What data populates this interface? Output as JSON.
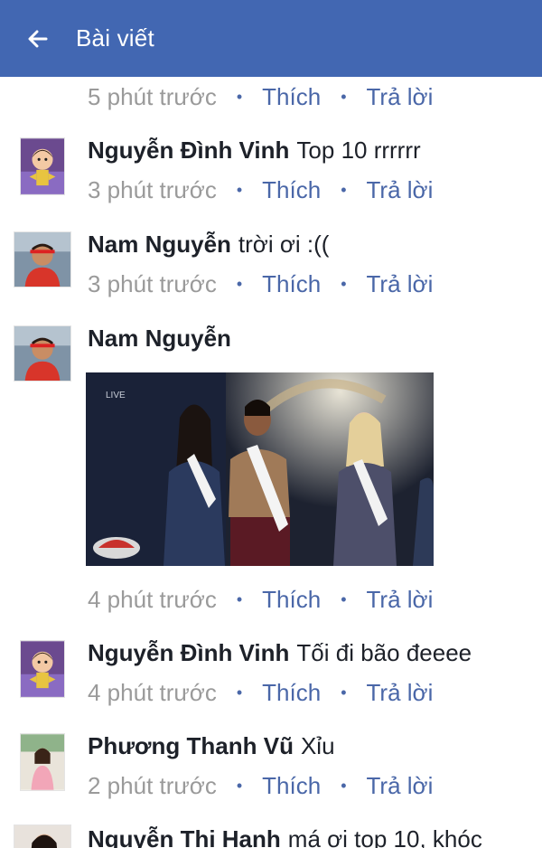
{
  "header": {
    "back_icon": "back-arrow-icon",
    "title": "Bài viết"
  },
  "actions": {
    "like": "Thích",
    "reply": "Trả lời",
    "separator": "•"
  },
  "top_meta": {
    "time": "5 phút trước"
  },
  "comments": [
    {
      "name": "Nguyễn Đình Vinh",
      "text": "Top 10 rrrrrr",
      "time": "3 phút trước"
    },
    {
      "name": "Nam Nguyễn",
      "text": "trời ơi :((",
      "time": "3 phút trước"
    },
    {
      "name": "Nam Nguyễn",
      "text": "",
      "time": "4 phút trước",
      "photo_label": "LIVE"
    },
    {
      "name": "Nguyễn Đình Vinh",
      "text": "Tối đi bão đeeee",
      "time": "4 phút trước"
    },
    {
      "name": "Phương Thanh Vũ",
      "text": "Xỉu",
      "time": "2 phút trước"
    },
    {
      "name": "Nguyễn Thị Hạnh",
      "text": "má ơi top 10, khóc"
    }
  ],
  "colors": {
    "header": "#4267b2",
    "link": "#4a67a8",
    "muted": "#9a9a9a",
    "text": "#1d2129"
  }
}
